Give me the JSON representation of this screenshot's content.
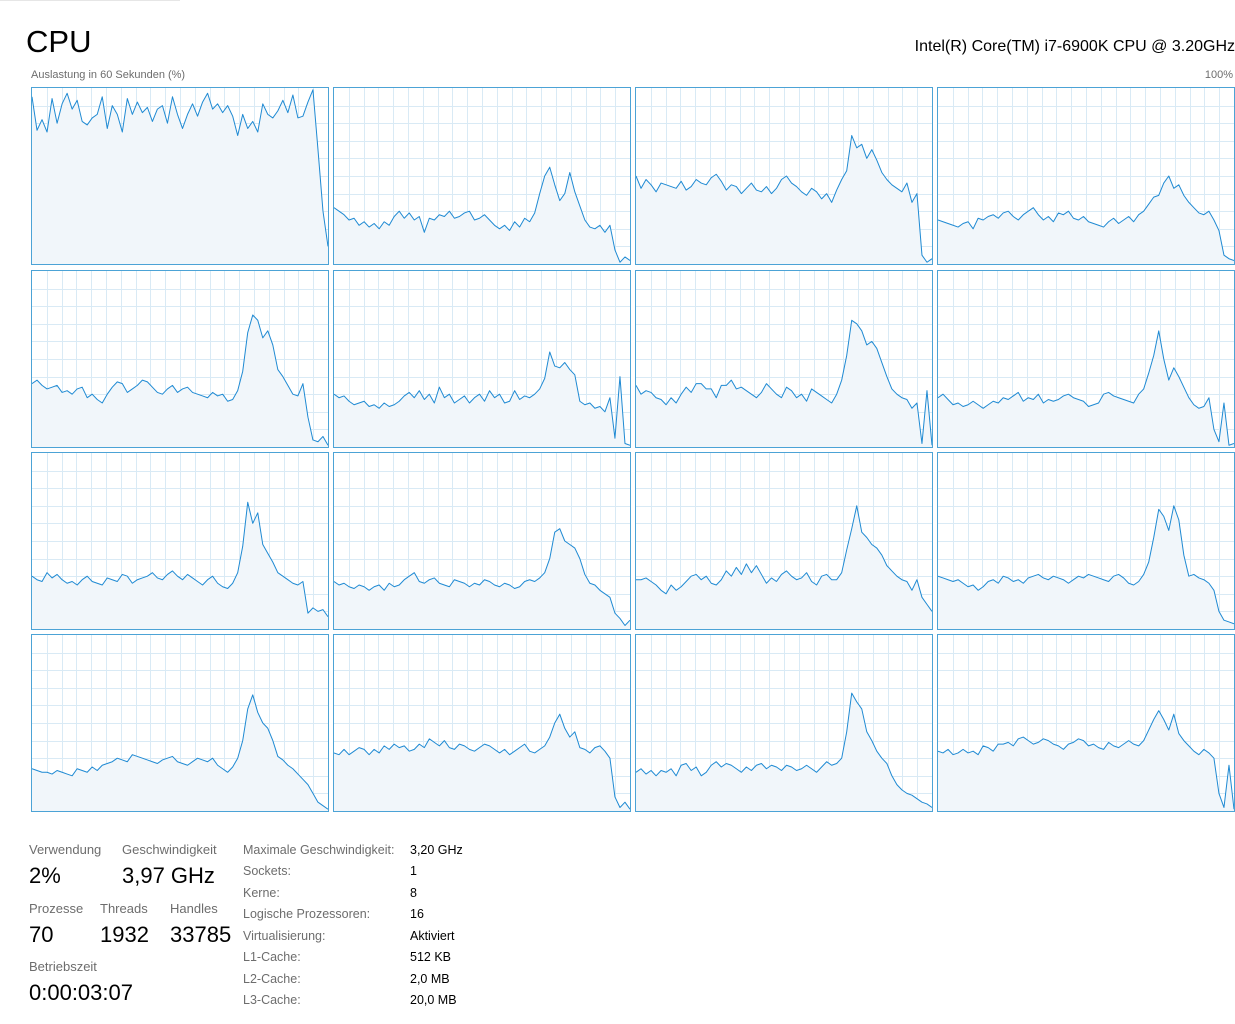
{
  "header": {
    "title": "CPU",
    "processor": "Intel(R) Core(TM) i7-6900K CPU @ 3.20GHz",
    "graph_label": "Auslastung in 60 Sekunden (%)",
    "graph_max": "100%"
  },
  "colors": {
    "line": "#1f8ad3",
    "fill": "#f1f6fa",
    "border": "#4ca3d6",
    "grid": "#d9eaf5"
  },
  "chart_data": {
    "type": "area",
    "xlabel": "Auslastung in 60 Sekunden (%)",
    "ylim": [
      0,
      100
    ],
    "grid": true,
    "points_per_series": 60,
    "series": [
      {
        "values": [
          95,
          76,
          82,
          75,
          94,
          80,
          91,
          97,
          88,
          93,
          81,
          79,
          83,
          85,
          95,
          77,
          90,
          85,
          75,
          94,
          85,
          92,
          86,
          89,
          81,
          88,
          90,
          80,
          95,
          85,
          77,
          85,
          91,
          84,
          92,
          97,
          88,
          91,
          86,
          90,
          84,
          73,
          85,
          77,
          81,
          75,
          91,
          85,
          83,
          87,
          93,
          86,
          96,
          83,
          84,
          92,
          99,
          65,
          30,
          10
        ]
      },
      {
        "values": [
          32,
          30,
          28,
          25,
          26,
          22,
          24,
          21,
          23,
          20,
          24,
          22,
          27,
          30,
          26,
          29,
          25,
          27,
          18,
          26,
          25,
          28,
          27,
          30,
          26,
          27,
          29,
          30,
          25,
          26,
          28,
          25,
          22,
          20,
          22,
          19,
          24,
          21,
          26,
          24,
          29,
          40,
          50,
          55,
          45,
          36,
          40,
          52,
          41,
          33,
          25,
          21,
          20,
          22,
          18,
          22,
          8,
          1,
          4,
          2
        ]
      },
      {
        "values": [
          50,
          43,
          48,
          45,
          41,
          46,
          45,
          44,
          43,
          47,
          42,
          44,
          48,
          46,
          45,
          49,
          51,
          47,
          42,
          45,
          44,
          40,
          43,
          46,
          42,
          41,
          44,
          40,
          43,
          48,
          50,
          46,
          44,
          41,
          39,
          43,
          41,
          37,
          40,
          35,
          42,
          48,
          53,
          73,
          66,
          68,
          60,
          65,
          59,
          52,
          48,
          45,
          43,
          41,
          46,
          35,
          40,
          5,
          1,
          3
        ]
      },
      {
        "values": [
          25,
          24,
          23,
          22,
          21,
          23,
          24,
          20,
          26,
          25,
          27,
          28,
          26,
          29,
          30,
          27,
          25,
          28,
          30,
          32,
          28,
          25,
          27,
          24,
          29,
          28,
          30,
          26,
          25,
          27,
          24,
          23,
          22,
          21,
          24,
          26,
          23,
          25,
          27,
          24,
          28,
          30,
          34,
          38,
          39,
          46,
          50,
          43,
          45,
          39,
          35,
          32,
          29,
          28,
          30,
          25,
          19,
          5,
          3,
          2
        ]
      },
      {
        "values": [
          36,
          38,
          35,
          33,
          34,
          35,
          31,
          32,
          30,
          33,
          34,
          28,
          30,
          27,
          25,
          30,
          34,
          37,
          36,
          31,
          33,
          35,
          38,
          37,
          34,
          31,
          30,
          33,
          35,
          31,
          33,
          34,
          31,
          30,
          29,
          28,
          31,
          29,
          30,
          26,
          27,
          32,
          43,
          65,
          75,
          72,
          62,
          66,
          58,
          44,
          40,
          35,
          30,
          29,
          36,
          17,
          4,
          3,
          6,
          1
        ]
      },
      {
        "values": [
          30,
          28,
          29,
          26,
          24,
          25,
          26,
          23,
          24,
          22,
          25,
          23,
          24,
          26,
          29,
          31,
          28,
          32,
          27,
          30,
          25,
          34,
          28,
          30,
          25,
          27,
          29,
          25,
          28,
          30,
          26,
          32,
          28,
          30,
          25,
          26,
          32,
          27,
          29,
          28,
          30,
          33,
          39,
          54,
          46,
          45,
          48,
          44,
          41,
          26,
          24,
          25,
          22,
          23,
          20,
          28,
          5,
          40,
          2,
          1
        ]
      },
      {
        "values": [
          35,
          30,
          32,
          31,
          28,
          27,
          24,
          28,
          25,
          30,
          34,
          31,
          36,
          36,
          33,
          33,
          28,
          35,
          35,
          38,
          33,
          34,
          32,
          30,
          28,
          31,
          36,
          33,
          30,
          28,
          34,
          32,
          28,
          30,
          26,
          33,
          31,
          29,
          27,
          25,
          30,
          38,
          52,
          72,
          70,
          66,
          58,
          60,
          56,
          48,
          40,
          33,
          30,
          28,
          27,
          22,
          25,
          2,
          32,
          1
        ]
      },
      {
        "values": [
          28,
          30,
          27,
          24,
          25,
          23,
          24,
          26,
          24,
          22,
          24,
          26,
          25,
          28,
          27,
          29,
          31,
          26,
          28,
          27,
          30,
          25,
          27,
          26,
          27,
          29,
          30,
          28,
          27,
          26,
          23,
          24,
          25,
          30,
          31,
          29,
          28,
          27,
          26,
          25,
          30,
          33,
          42,
          52,
          66,
          50,
          38,
          45,
          40,
          34,
          28,
          24,
          22,
          23,
          28,
          10,
          3,
          25,
          1,
          2
        ]
      },
      {
        "values": [
          30,
          28,
          27,
          32,
          29,
          31,
          28,
          26,
          27,
          25,
          28,
          30,
          27,
          26,
          25,
          29,
          28,
          27,
          31,
          30,
          26,
          28,
          29,
          30,
          32,
          29,
          28,
          31,
          33,
          30,
          28,
          31,
          29,
          27,
          25,
          28,
          30,
          26,
          24,
          23,
          26,
          32,
          47,
          72,
          60,
          66,
          48,
          43,
          38,
          32,
          30,
          28,
          26,
          25,
          27,
          9,
          12,
          10,
          11,
          7
        ]
      },
      {
        "values": [
          27,
          25,
          26,
          24,
          23,
          25,
          24,
          22,
          24,
          25,
          22,
          26,
          24,
          25,
          28,
          30,
          32,
          27,
          26,
          28,
          29,
          26,
          25,
          24,
          28,
          27,
          26,
          24,
          26,
          25,
          28,
          27,
          25,
          24,
          26,
          25,
          23,
          24,
          27,
          28,
          27,
          29,
          32,
          40,
          55,
          57,
          50,
          48,
          46,
          40,
          31,
          26,
          25,
          22,
          20,
          18,
          9,
          6,
          2,
          5
        ]
      },
      {
        "values": [
          28,
          28,
          29,
          27,
          25,
          22,
          20,
          25,
          22,
          24,
          27,
          30,
          31,
          28,
          30,
          26,
          25,
          28,
          33,
          30,
          35,
          31,
          37,
          32,
          36,
          31,
          26,
          29,
          27,
          31,
          33,
          30,
          28,
          29,
          32,
          27,
          25,
          30,
          31,
          28,
          28,
          32,
          45,
          57,
          70,
          55,
          52,
          48,
          46,
          42,
          36,
          33,
          30,
          28,
          27,
          22,
          28,
          18,
          14,
          10
        ]
      },
      {
        "values": [
          30,
          29,
          28,
          27,
          28,
          26,
          24,
          25,
          22,
          24,
          27,
          28,
          26,
          30,
          29,
          27,
          28,
          26,
          29,
          30,
          31,
          29,
          28,
          30,
          29,
          28,
          26,
          28,
          30,
          29,
          31,
          30,
          29,
          28,
          27,
          30,
          31,
          29,
          26,
          25,
          27,
          31,
          38,
          52,
          68,
          64,
          56,
          70,
          62,
          42,
          30,
          31,
          29,
          28,
          26,
          22,
          10,
          5,
          4,
          3
        ]
      },
      {
        "values": [
          24,
          23,
          22,
          22,
          21,
          23,
          22,
          21,
          20,
          24,
          23,
          22,
          25,
          23,
          26,
          27,
          28,
          30,
          29,
          28,
          32,
          31,
          30,
          29,
          28,
          27,
          29,
          30,
          31,
          28,
          27,
          26,
          28,
          30,
          29,
          28,
          30,
          26,
          24,
          22,
          25,
          30,
          40,
          58,
          66,
          56,
          50,
          47,
          40,
          31,
          29,
          26,
          24,
          21,
          18,
          15,
          10,
          5,
          3,
          1
        ]
      },
      {
        "values": [
          33,
          32,
          35,
          32,
          34,
          36,
          35,
          32,
          35,
          33,
          37,
          35,
          38,
          36,
          37,
          34,
          35,
          38,
          36,
          41,
          39,
          37,
          40,
          36,
          35,
          38,
          37,
          35,
          34,
          36,
          38,
          37,
          35,
          33,
          35,
          32,
          34,
          36,
          38,
          34,
          33,
          35,
          37,
          42,
          50,
          55,
          47,
          42,
          45,
          36,
          35,
          33,
          36,
          37,
          34,
          30,
          8,
          2,
          5,
          1
        ]
      },
      {
        "values": [
          22,
          24,
          21,
          23,
          20,
          23,
          22,
          24,
          20,
          26,
          27,
          23,
          25,
          20,
          22,
          26,
          28,
          25,
          27,
          26,
          24,
          22,
          25,
          23,
          26,
          27,
          24,
          26,
          25,
          23,
          26,
          25,
          23,
          24,
          26,
          24,
          22,
          25,
          28,
          26,
          27,
          30,
          45,
          67,
          62,
          58,
          45,
          40,
          34,
          30,
          27,
          20,
          15,
          12,
          10,
          9,
          7,
          5,
          4,
          2
        ]
      },
      {
        "values": [
          34,
          33,
          35,
          32,
          33,
          35,
          33,
          34,
          32,
          37,
          36,
          34,
          38,
          38,
          39,
          37,
          41,
          42,
          40,
          38,
          39,
          41,
          40,
          38,
          37,
          35,
          38,
          39,
          41,
          40,
          37,
          38,
          36,
          35,
          39,
          37,
          36,
          38,
          40,
          38,
          37,
          40,
          46,
          52,
          57,
          52,
          46,
          55,
          44,
          40,
          37,
          34,
          32,
          35,
          33,
          30,
          10,
          2,
          26,
          1
        ]
      }
    ]
  },
  "stats": {
    "verwendung": {
      "label": "Verwendung",
      "value": "2%"
    },
    "geschwindigkeit": {
      "label": "Geschwindigkeit",
      "value": "3,97 GHz"
    },
    "prozesse": {
      "label": "Prozesse",
      "value": "70"
    },
    "threads": {
      "label": "Threads",
      "value": "1932"
    },
    "handles": {
      "label": "Handles",
      "value": "33785"
    },
    "betriebszeit": {
      "label": "Betriebszeit",
      "value": "0:00:03:07"
    }
  },
  "info": [
    {
      "label": "Maximale Geschwindigkeit:",
      "value": "3,20 GHz"
    },
    {
      "label": "Sockets:",
      "value": "1"
    },
    {
      "label": "Kerne:",
      "value": "8"
    },
    {
      "label": "Logische Prozessoren:",
      "value": "16"
    },
    {
      "label": "Virtualisierung:",
      "value": "Aktiviert"
    },
    {
      "label": "L1-Cache:",
      "value": "512 KB"
    },
    {
      "label": "L2-Cache:",
      "value": "2,0 MB"
    },
    {
      "label": "L3-Cache:",
      "value": "20,0 MB"
    }
  ]
}
